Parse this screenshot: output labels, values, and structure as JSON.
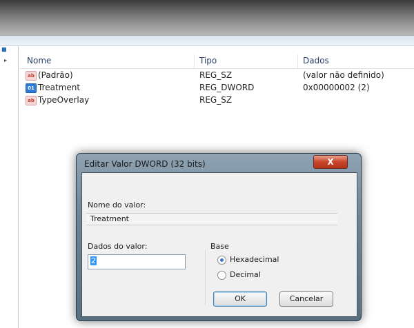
{
  "list": {
    "headers": {
      "name": "Nome",
      "type": "Tipo",
      "data": "Dados"
    },
    "rows": [
      {
        "icon": "string-value-icon",
        "name": "(Padrão)",
        "type": "REG_SZ",
        "data": "(valor não definido)"
      },
      {
        "icon": "dword-value-icon",
        "name": "Treatment",
        "type": "REG_DWORD",
        "data": "0x00000002 (2)"
      },
      {
        "icon": "string-value-icon",
        "name": "TypeOverlay",
        "type": "REG_SZ",
        "data": ""
      }
    ]
  },
  "dialog": {
    "title": "Editar Valor DWORD (32 bits)",
    "close_label": "X",
    "value_name_label": "Nome do valor:",
    "value_name": "Treatment",
    "value_data_label": "Dados do valor:",
    "value_data": "2",
    "base_label": "Base",
    "radio_hex": "Hexadecimal",
    "radio_dec": "Decimal",
    "ok_label": "OK",
    "cancel_label": "Cancelar"
  }
}
